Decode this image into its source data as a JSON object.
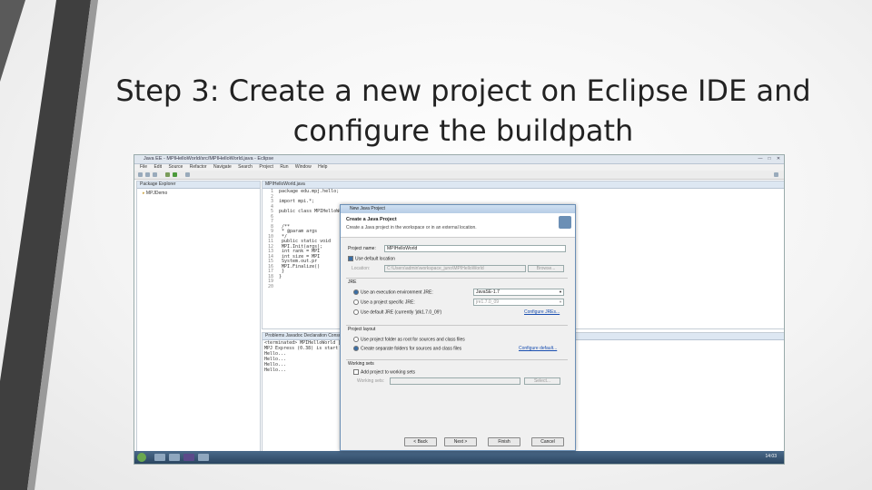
{
  "slide": {
    "title_line1": "Step 3: Create a new project on Eclipse IDE and",
    "title_line2": "configure the buildpath"
  },
  "eclipse": {
    "window_title": "Java EE - MPIHelloWorld/src/MPIHelloWorld.java - Eclipse",
    "menu": [
      "File",
      "Edit",
      "Source",
      "Refactor",
      "Navigate",
      "Search",
      "Project",
      "Run",
      "Window",
      "Help"
    ],
    "package_explorer_tab": "Package Explorer",
    "tree_item": "MPJDemo",
    "editor_tab": "MPIHelloWorld.java",
    "code_lines": [
      {
        "n": "1",
        "t": "package edu.mpj.hello;"
      },
      {
        "n": "2",
        "t": ""
      },
      {
        "n": "3",
        "t": "import mpi.*;"
      },
      {
        "n": "4",
        "t": ""
      },
      {
        "n": "5",
        "t": "public class MPIHelloWorld {"
      },
      {
        "n": "6",
        "t": ""
      },
      {
        "n": "7",
        "t": ""
      },
      {
        "n": "8",
        "t": "    /**"
      },
      {
        "n": "9",
        "t": "     * @param args"
      },
      {
        "n": "10",
        "t": "     */"
      },
      {
        "n": "11",
        "t": "    public static void"
      },
      {
        "n": "12",
        "t": "        MPI.Init(args);"
      },
      {
        "n": "13",
        "t": "        int rank = MPI"
      },
      {
        "n": "14",
        "t": "        int size = MPI"
      },
      {
        "n": "15",
        "t": "        System.out.pr"
      },
      {
        "n": "16",
        "t": "        MPI.Finalize()"
      },
      {
        "n": "17",
        "t": "    }"
      },
      {
        "n": "18",
        "t": "}"
      },
      {
        "n": "19",
        "t": ""
      },
      {
        "n": "20",
        "t": ""
      }
    ],
    "console_tabs": "Problems  Javadoc  Declaration  Console",
    "console_lines": [
      "<terminated> MPIHelloWorld [Java",
      "MPJ Express (0.38) is start",
      "Hello...",
      "Hello...",
      "Hello...",
      "Hello..."
    ],
    "clock": "14:03"
  },
  "dialog": {
    "window_title": "New Java Project",
    "header_title": "Create a Java Project",
    "header_desc": "Create a Java project in the workspace or in an external location.",
    "project_name_label": "Project name:",
    "project_name_value": "MPIHelloWorld",
    "use_default_location": "Use default location",
    "location_label": "Location:",
    "location_value": "C:\\Users\\admin\\workspace_juno\\MPIHelloWorld",
    "browse_label": "Browse...",
    "jre_group": "JRE",
    "jre_option1": "Use an execution environment JRE:",
    "jre_option1_value": "JavaSE-1.7",
    "jre_option2": "Use a project specific JRE:",
    "jre_option2_value": "jre1.7.0_09",
    "jre_option3": "Use default JRE (currently 'jdk1.7.0_09')",
    "configure_jres": "Configure JREs...",
    "layout_group": "Project layout",
    "layout_option1": "Use project folder as root for sources and class files",
    "layout_option2": "Create separate folders for sources and class files",
    "configure_default": "Configure default...",
    "working_sets_group": "Working sets",
    "add_working_set": "Add project to working sets",
    "working_sets_label": "Working sets:",
    "select_label": "Select...",
    "buttons": {
      "back": "< Back",
      "next": "Next >",
      "finish": "Finish",
      "cancel": "Cancel"
    }
  }
}
